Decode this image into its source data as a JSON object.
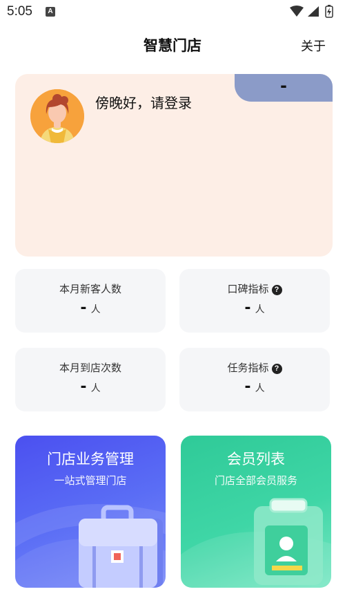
{
  "status": {
    "time": "5:05",
    "notif_letter": "A"
  },
  "header": {
    "title": "智慧门店",
    "about_label": "关于"
  },
  "welcome": {
    "tag": "-",
    "greeting": "傍晚好，请登录"
  },
  "stats": [
    {
      "label": "本月新客人数",
      "value": "-",
      "unit": "人",
      "help": false
    },
    {
      "label": "口碑指标",
      "value": "-",
      "unit": "人",
      "help": true
    },
    {
      "label": "本月到店次数",
      "value": "-",
      "unit": "人",
      "help": false
    },
    {
      "label": "任务指标",
      "value": "-",
      "unit": "人",
      "help": true
    }
  ],
  "features": [
    {
      "title": "门店业务管理",
      "subtitle": "一站式管理门店",
      "icon": "briefcase-icon",
      "color": "#4b50f0"
    },
    {
      "title": "会员列表",
      "subtitle": "门店全部会员服务",
      "icon": "clipboard-member-icon",
      "color": "#2fca98"
    }
  ],
  "help_glyph": "?"
}
